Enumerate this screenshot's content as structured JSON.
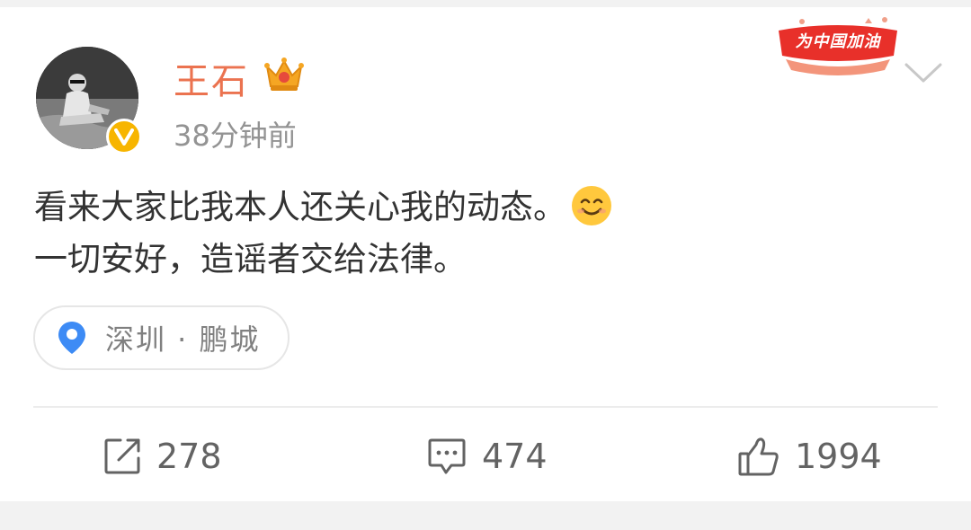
{
  "post": {
    "author": "王石",
    "time": "38分钟前",
    "text_line1": "看来大家比我本人还关心我的动态。",
    "text_line2": "一切安好，造谣者交给法律。",
    "emoji": "smiling-face",
    "location": "深圳 · 鹏城"
  },
  "badge": {
    "promo_text": "为中国加油"
  },
  "actions": {
    "repost_count": "278",
    "comment_count": "474",
    "like_count": "1994"
  },
  "colors": {
    "username": "#eb7350",
    "verified": "#f7b500",
    "pin": "#3d8bf5",
    "promo": "#e8302a"
  },
  "icons": {
    "verified": "verified-v-icon",
    "crown": "crown-icon",
    "menu": "chevron-down-icon",
    "location": "location-pin-icon",
    "repost": "repost-icon",
    "comment": "comment-icon",
    "like": "thumbs-up-icon"
  }
}
